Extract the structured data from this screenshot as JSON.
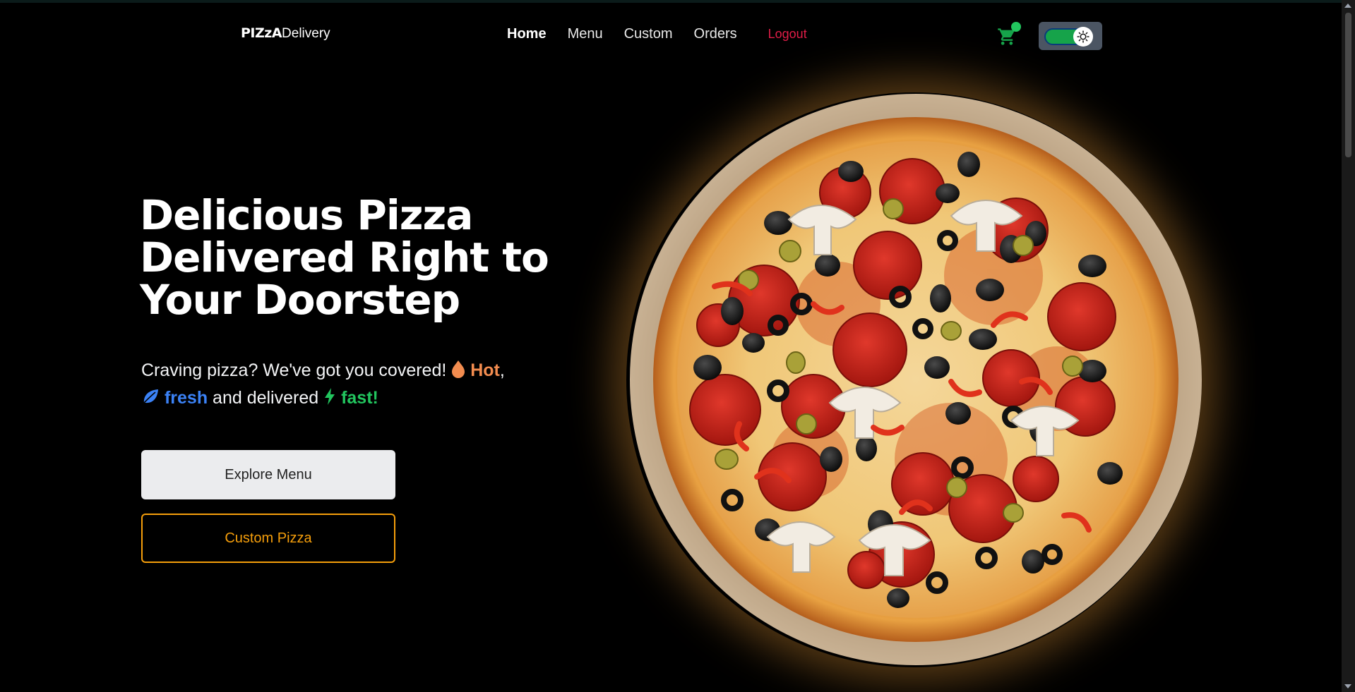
{
  "nav": {
    "brand": "PIZzA",
    "brand_suffix": "Delivery",
    "links": [
      "Home",
      "Menu",
      "Custom",
      "Orders"
    ],
    "logout": "Logout"
  },
  "hero": {
    "title_lines": [
      "Delicious Pizza",
      "Delivered Right to",
      "Your Doorstep"
    ],
    "tagline_start": "Craving pizza? We've got you covered! ",
    "hot": "Hot",
    "comma": ",",
    "fresh": "fresh",
    "delivered": " and delivered ",
    "fast": "fast!",
    "explore_button": "Explore Menu",
    "custom_button": "Custom Pizza"
  },
  "icons": {
    "cart": "shopping-cart-icon",
    "theme": "sun-icon",
    "hot": "flame-icon",
    "fresh": "leaf-icon",
    "fast": "lightning-icon"
  },
  "colors": {
    "background": "#000000",
    "logout": "#e11d48",
    "hot": "#f28c4f",
    "fresh": "#3b82f6",
    "fast": "#22c55e",
    "accent_border": "#f59e0b",
    "cart_dot": "#22c55e",
    "toggle_on": "#16a34a"
  },
  "toggle": {
    "state": "on"
  }
}
